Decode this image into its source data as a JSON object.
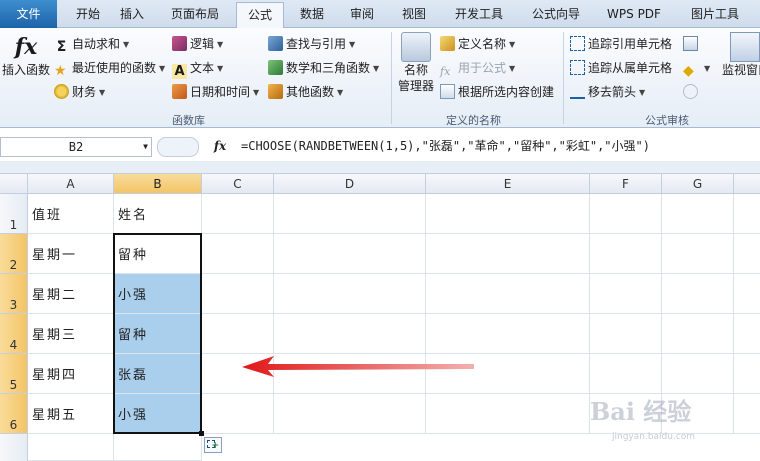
{
  "tabs": [
    "文件",
    "开始",
    "插入",
    "页面布局",
    "公式",
    "数据",
    "审阅",
    "视图",
    "开发工具",
    "公式向导",
    "WPS PDF",
    "图片工具"
  ],
  "active_tab": "公式",
  "ribbon": {
    "insert_function": "插入函数",
    "autosum": "自动求和",
    "recent": "最近使用的函数",
    "finance": "财务",
    "logic": "逻辑",
    "text": "文本",
    "datetime": "日期和时间",
    "lookup": "查找与引用",
    "math": "数学和三角函数",
    "other": "其他函数",
    "group_library": "函数库",
    "name_manager_1": "名称",
    "name_manager_2": "管理器",
    "define_name": "定义名称",
    "use_in_formula": "用于公式",
    "create_from_sel": "根据所选内容创建",
    "group_names": "定义的名称",
    "trace_precedents": "追踪引用单元格",
    "trace_dependents": "追踪从属单元格",
    "remove_arrows": "移去箭头",
    "group_audit": "公式审核",
    "watch_window": "监视窗口"
  },
  "formula_bar": {
    "name_box": "B2",
    "fx_label": "fx",
    "formula": "=CHOOSE(RANDBETWEEN(1,5),\"张磊\",\"革命\",\"留种\",\"彩虹\",\"小强\")"
  },
  "columns": [
    "A",
    "B",
    "C",
    "D",
    "E",
    "F",
    "G"
  ],
  "rows": [
    "1",
    "2",
    "3",
    "4",
    "5",
    "6"
  ],
  "cells": {
    "A": [
      "值班",
      "星期一",
      "星期二",
      "星期三",
      "星期四",
      "星期五"
    ],
    "B": [
      "姓名",
      "留种",
      "小强",
      "留种",
      "张磊",
      "小强"
    ]
  },
  "watermark": {
    "main": "Bai 经验",
    "sub": "jingyan.baidu.com"
  },
  "colors": {
    "selection_fill": "#a9cfed",
    "header_highlight": "#f3c466",
    "arrow": "#e02020"
  }
}
